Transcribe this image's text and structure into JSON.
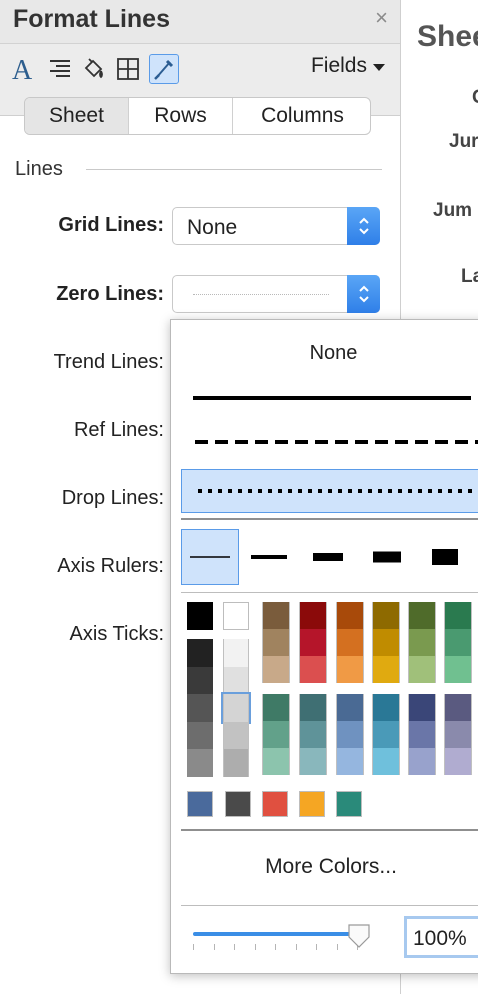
{
  "panel": {
    "title": "Format Lines",
    "close_symbol": "×",
    "toolbar": {
      "icons": [
        "font-icon",
        "alignment-icon",
        "shading-icon",
        "borders-icon",
        "lines-icon"
      ],
      "active_icon": "lines-icon",
      "fields_label": "Fields"
    },
    "tabs": [
      "Sheet",
      "Rows",
      "Columns"
    ],
    "selected_tab": "Sheet",
    "section_title": "Lines",
    "properties": {
      "grid_lines": {
        "label": "Grid Lines:",
        "value": "None"
      },
      "zero_lines": {
        "label": "Zero Lines:"
      },
      "trend_lines": {
        "label": "Trend Lines:"
      },
      "ref_lines": {
        "label": "Ref Lines:"
      },
      "drop_lines": {
        "label": "Drop Lines:"
      },
      "axis_rulers": {
        "label": "Axis Rulers:"
      },
      "axis_ticks": {
        "label": "Axis Ticks:"
      }
    }
  },
  "sheet": {
    "title": "Shee",
    "row_labels": [
      "C",
      "Jur",
      "Jum",
      "La"
    ]
  },
  "dropdown": {
    "none_label": "None",
    "line_styles": [
      "solid",
      "dashed",
      "dotted"
    ],
    "selected_line_style": "dotted",
    "weights": [
      1,
      2,
      3,
      4,
      5
    ],
    "selected_weight": 1,
    "palette": {
      "grays_top": [
        "#000000",
        "#ffffff"
      ],
      "color_columns_top": [
        [
          "#7a5c3c",
          "#a0835f",
          "#c8a989"
        ],
        [
          "#8b0a0a",
          "#b5152a",
          "#db4f4f"
        ],
        [
          "#a84a0a",
          "#d47020",
          "#f09a45"
        ],
        [
          "#8e6a00",
          "#c08c00",
          "#e0aa10"
        ],
        [
          "#4f6b2a",
          "#7a9a4f",
          "#a0c07a"
        ],
        [
          "#2a7a4f",
          "#4a9a70",
          "#70c090"
        ]
      ],
      "dark_gray_column": [
        "#222222",
        "#3a3a3a",
        "#555555",
        "#6d6d6d",
        "#8a8a8a"
      ],
      "light_gray_column": [
        "#f2f2f2",
        "#e0e0e0",
        "#d4d4d4",
        "#c2c2c2",
        "#adadad"
      ],
      "selected_light_gray": "#d4d4d4",
      "color_columns_bottom": [
        [
          "#3f7a66",
          "#62a18a",
          "#8cc4ad"
        ],
        [
          "#3f6f73",
          "#5f9399",
          "#89b7bc"
        ],
        [
          "#4a6a94",
          "#6f92c0",
          "#95b6df"
        ],
        [
          "#2a7896",
          "#4a9ab8",
          "#6fc0dc"
        ],
        [
          "#3a4678",
          "#6a76a8",
          "#98a2cc"
        ],
        [
          "#5a5a80",
          "#8a8aac",
          "#b0acd0"
        ]
      ],
      "recent": [
        "#4a6a9c",
        "#4a4a4a",
        "#e05040",
        "#f5a623",
        "#2a8a7a"
      ]
    },
    "more_colors_label": "More Colors...",
    "opacity_value": "100%",
    "opacity_fraction": 1.0
  }
}
